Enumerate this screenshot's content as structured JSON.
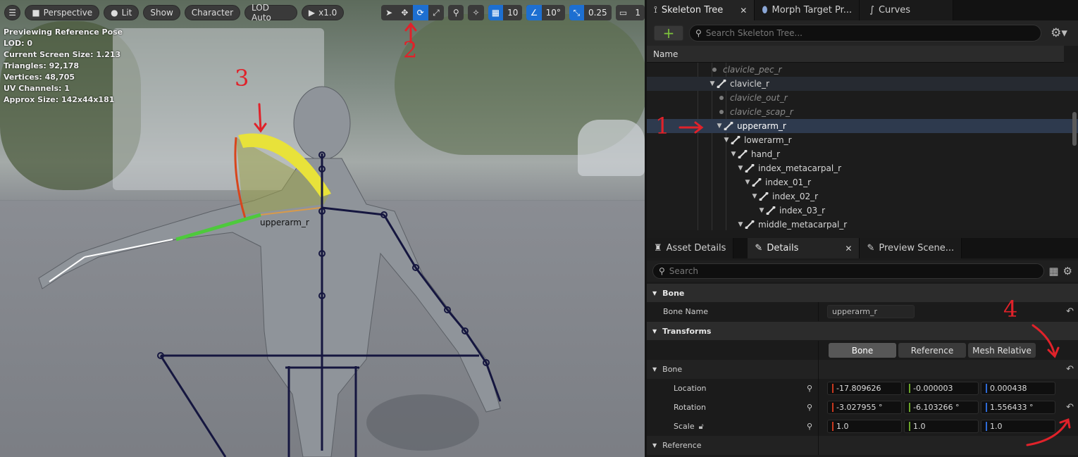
{
  "toolbar": {
    "perspective": "Perspective",
    "lit": "Lit",
    "show": "Show",
    "character": "Character",
    "lod": "LOD Auto",
    "play_speed": "x1.0",
    "grid_snap": "10",
    "angle_snap": "10°",
    "scale_snap": "0.25",
    "camera_speed": "1"
  },
  "stats": [
    "Previewing Reference Pose",
    "LOD: 0",
    "Current Screen Size: 1.213",
    "Triangles: 92,178",
    "Vertices: 48,705",
    "UV Channels: 1",
    "Approx Size: 142x44x181"
  ],
  "viewport_bone_label": "upperarm_r",
  "annotations": {
    "n1": "1",
    "n2": "2",
    "n3": "3",
    "n4": "4"
  },
  "top_tabs": [
    "Skeleton Tree",
    "Morph Target Pr...",
    "Curves"
  ],
  "skeleton_search_placeholder": "Search Skeleton Tree...",
  "tree_header": "Name",
  "tree_rows": [
    {
      "label": "clavicle_pec_r",
      "indent": 0,
      "type": "dot"
    },
    {
      "label": "clavicle_r",
      "indent": 0,
      "type": "bone"
    },
    {
      "label": "clavicle_out_r",
      "indent": 1,
      "type": "dot"
    },
    {
      "label": "clavicle_scap_r",
      "indent": 1,
      "type": "dot"
    },
    {
      "label": "upperarm_r",
      "indent": 1,
      "type": "bone"
    },
    {
      "label": "lowerarm_r",
      "indent": 2,
      "type": "bone"
    },
    {
      "label": "hand_r",
      "indent": 3,
      "type": "bone"
    },
    {
      "label": "index_metacarpal_r",
      "indent": 4,
      "type": "bone"
    },
    {
      "label": "index_01_r",
      "indent": 5,
      "type": "bone"
    },
    {
      "label": "index_02_r",
      "indent": 6,
      "type": "bone"
    },
    {
      "label": "index_03_r",
      "indent": 7,
      "type": "bone"
    },
    {
      "label": "middle_metacarpal_r",
      "indent": 4,
      "type": "bone"
    }
  ],
  "bottom_tabs": [
    "Asset Details",
    "Details",
    "Preview Scene..."
  ],
  "details_search_placeholder": "Search",
  "details": {
    "section_bone": "Bone",
    "bone_name_label": "Bone Name",
    "bone_name_value": "upperarm_r",
    "section_transforms": "Transforms",
    "mode_buttons": [
      "Bone",
      "Reference",
      "Mesh Relative"
    ],
    "sub_bone": "Bone",
    "location_label": "Location",
    "location": [
      "-17.809626",
      "-0.000003",
      "0.000438"
    ],
    "rotation_label": "Rotation",
    "rotation": [
      "-3.027955 °",
      "-6.103266 °",
      "1.556433 °"
    ],
    "scale_label": "Scale",
    "scale": [
      "1.0",
      "1.0",
      "1.0"
    ],
    "section_reference": "Reference"
  },
  "colors": {
    "accent": "#1d6fd1",
    "x": "#c9381f",
    "y": "#6aa52a",
    "z": "#2d6ad6",
    "annotation": "#e0222a"
  }
}
